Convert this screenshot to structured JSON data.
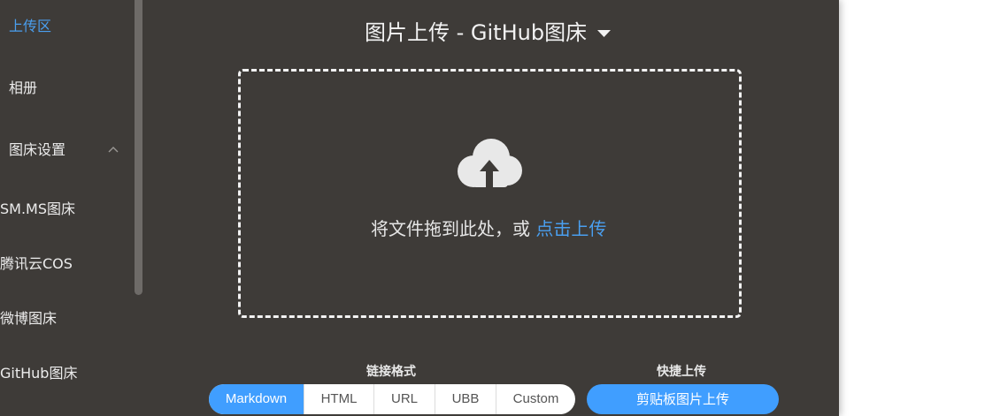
{
  "sidebar": {
    "items": [
      {
        "label": "上传区",
        "active": true
      },
      {
        "label": "相册"
      },
      {
        "label": "图床设置",
        "expanded": true
      }
    ],
    "sub_items": [
      {
        "label": "SM.MS图床"
      },
      {
        "label": "腾讯云COS"
      },
      {
        "label": "微博图床"
      },
      {
        "label": "GitHub图床"
      }
    ]
  },
  "main": {
    "title": "图片上传 - GitHub图床",
    "drop_text": "将文件拖到此处，或 ",
    "drop_link": "点击上传",
    "link_format_label": "链接格式",
    "formats": [
      "Markdown",
      "HTML",
      "URL",
      "UBB",
      "Custom"
    ],
    "selected_format": "Markdown",
    "quick_upload_label": "快捷上传",
    "paste_button": "剪贴板图片上传"
  },
  "colors": {
    "background": "#3e3b38",
    "accent": "#409eff",
    "active_text": "#4a9ff0"
  },
  "icons": {
    "upload": "cloud-upload-icon",
    "caret": "caret-down-icon",
    "chevron": "chevron-up-icon"
  }
}
